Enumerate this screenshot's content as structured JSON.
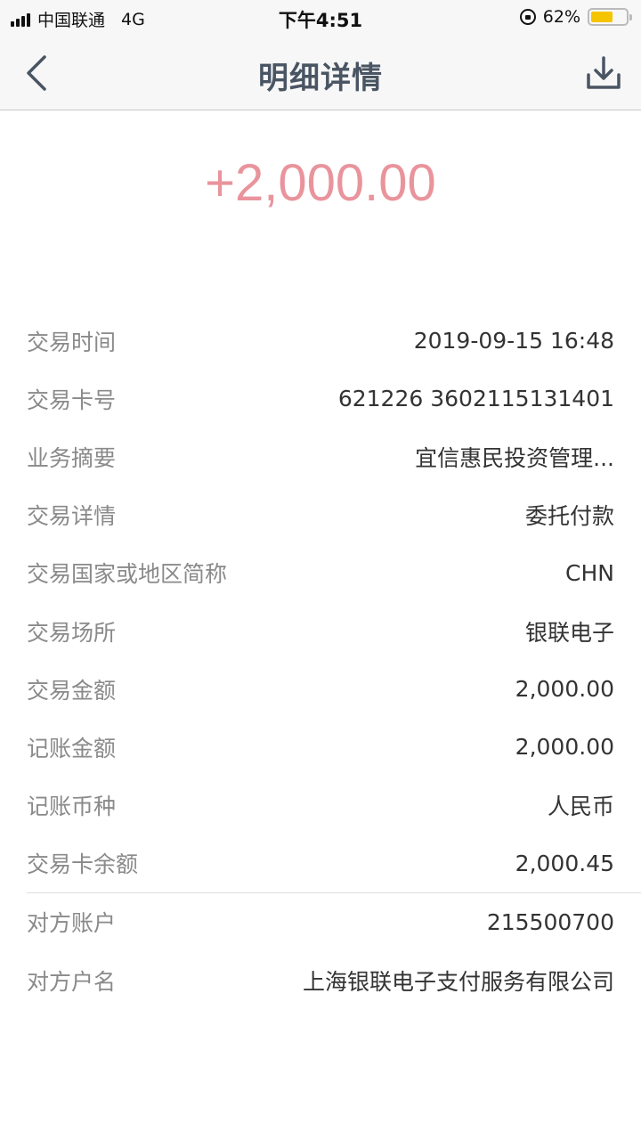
{
  "status_bar": {
    "carrier": "中国联通",
    "network": "4G",
    "time": "下午4:51",
    "battery_percent": "62%",
    "battery_level": 0.62
  },
  "nav": {
    "title": "明细详情"
  },
  "amount": "+2,000.00",
  "details_group1": [
    {
      "label": "交易时间",
      "value": "2019-09-15 16:48"
    },
    {
      "label": "交易卡号",
      "value": "621226 3602115131401"
    },
    {
      "label": "业务摘要",
      "value": "宜信惠民投资管理..."
    },
    {
      "label": "交易详情",
      "value": "委托付款"
    },
    {
      "label": "交易国家或地区简称",
      "value": "CHN"
    },
    {
      "label": "交易场所",
      "value": "银联电子"
    },
    {
      "label": "交易金额",
      "value": "2,000.00"
    },
    {
      "label": "记账金额",
      "value": "2,000.00"
    },
    {
      "label": "记账币种",
      "value": "人民币"
    },
    {
      "label": "交易卡余额",
      "value": "2,000.45"
    }
  ],
  "details_group2": [
    {
      "label": "对方账户",
      "value": "215500700"
    },
    {
      "label": "对方户名",
      "value": "上海银联电子支付服务有限公司"
    }
  ]
}
